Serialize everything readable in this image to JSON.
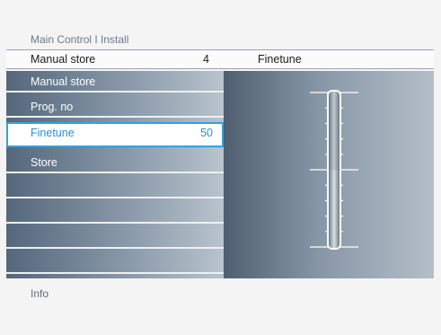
{
  "breadcrumb": "Main Control I Install",
  "header": {
    "title": "Manual store",
    "value": "4",
    "right_title": "Finetune"
  },
  "menu": {
    "items": [
      {
        "label": "Manual store",
        "value": ""
      },
      {
        "label": "Prog. no",
        "value": ""
      },
      {
        "label": "Finetune",
        "value": "50",
        "selected": true
      },
      {
        "label": "Store",
        "value": ""
      },
      {
        "label": "",
        "value": ""
      },
      {
        "label": "",
        "value": ""
      },
      {
        "label": "",
        "value": ""
      },
      {
        "label": "",
        "value": ""
      }
    ]
  },
  "slider": {
    "name": "finetune",
    "value": 50,
    "min": 0,
    "max": 100
  },
  "info_label": "Info",
  "colors": {
    "accent": "#3a9fd8",
    "panel_dark": "#4f5f71",
    "panel_light": "#b4bec8"
  }
}
